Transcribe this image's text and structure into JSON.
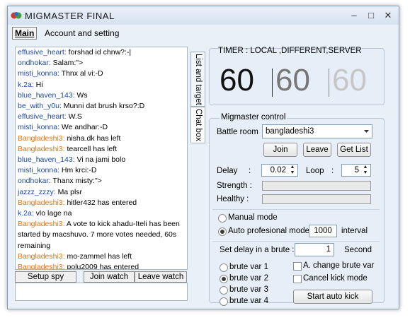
{
  "window": {
    "title": "MIGMASTER FINAL",
    "minimize_glyph": "–",
    "maximize_glyph": "□",
    "close_glyph": "✕"
  },
  "menu": {
    "main": "Main",
    "account": "Account and setting"
  },
  "chat": {
    "lines": [
      {
        "nick": "effusive_heart:",
        "text": " forshad id chnw?:-|",
        "color": "blue"
      },
      {
        "nick": "ondhokar:",
        "text": " Salam:\">",
        "color": "blue"
      },
      {
        "nick": "misti_konna:",
        "text": " Thnx al vi:-D",
        "color": "blue"
      },
      {
        "nick": "k.2a:",
        "text": " Hi",
        "color": "blue"
      },
      {
        "nick": "blue_haven_143:",
        "text": " Ws",
        "color": "blue"
      },
      {
        "nick": "be_with_y0u:",
        "text": " Munni dat brush krso?:D",
        "color": "blue"
      },
      {
        "nick": "effusive_heart:",
        "text": " W.S",
        "color": "blue"
      },
      {
        "nick": "misti_konna:",
        "text": " We andhar:-D",
        "color": "blue"
      },
      {
        "nick": "Bangladeshi3:",
        "text": " nisha.dk has left",
        "color": "orange"
      },
      {
        "nick": "Bangladeshi3:",
        "text": " tearcell has left",
        "color": "orange"
      },
      {
        "nick": "blue_haven_143:",
        "text": " Vi na jami bolo",
        "color": "blue"
      },
      {
        "nick": "misti_konna:",
        "text": " Hm krci:-D",
        "color": "blue"
      },
      {
        "nick": "ondhokar:",
        "text": " Thanx misty:\">",
        "color": "blue"
      },
      {
        "nick": "jazzz_zzzy:",
        "text": " Ma plsr",
        "color": "blue"
      },
      {
        "nick": "Bangladeshi3:",
        "text": " hitler432 has entered",
        "color": "orange"
      },
      {
        "nick": "k.2a:",
        "text": " vlo lage na",
        "color": "blue"
      },
      {
        "nick": "Bangladeshi3:",
        "text": " A vote to kick ahadu-Iteli has been started by macshuvo. 7 more votes needed, 60s remaining",
        "color": "orange"
      },
      {
        "nick": "Bangladeshi3:",
        "text": " mo-zammel has left",
        "color": "orange"
      },
      {
        "nick": "Bangladeshi3:",
        "text": " polu2009 has entered",
        "color": "orange"
      },
      {
        "nick": "be_with_y0u:",
        "text": " Misti khabo:D",
        "color": "blue"
      }
    ],
    "setup_spy": "Setup spy",
    "join_watch": "Join watch",
    "leave_watch": "Leave watch"
  },
  "tabs": {
    "list_and_target": "List and target",
    "chat_box": "Chat box"
  },
  "timer": {
    "label": "TIMER : LOCAL ,DIFFERENT,SERVER",
    "local": "60",
    "different": "60",
    "server": "60"
  },
  "control": {
    "label": "Migmaster control",
    "battle_room_label": "Battle room",
    "battle_room_value": "bangladeshi3",
    "join": "Join",
    "leave": "Leave",
    "get_list": "Get List",
    "delay_label": "Delay",
    "delay_colon": ":",
    "delay_value": "0.02",
    "loop_label": "Loop",
    "loop_colon": ":",
    "loop_value": "5",
    "strength_label": "Strength :",
    "healthy_label": "Healthy  :"
  },
  "mode": {
    "manual": "Manual mode",
    "auto": "Auto profesional mode",
    "auto_value": "1000",
    "interval": "interval"
  },
  "brute": {
    "set_delay_label": "Set delay in a brute :",
    "set_delay_value": "1",
    "second": "Second",
    "var1": "brute var 1",
    "var2": "brute var 2",
    "var3": "brute var 3",
    "var4": "brute var 4",
    "change": "A. change brute var",
    "cancel_kick": "Cancel kick mode",
    "start": "Start auto kick"
  },
  "colors": {
    "nick_blue": "#1a47a8",
    "nick_orange": "#e2760f",
    "timer_local": "#111111",
    "timer_different": "#777777",
    "timer_server": "#c6c6c6"
  }
}
